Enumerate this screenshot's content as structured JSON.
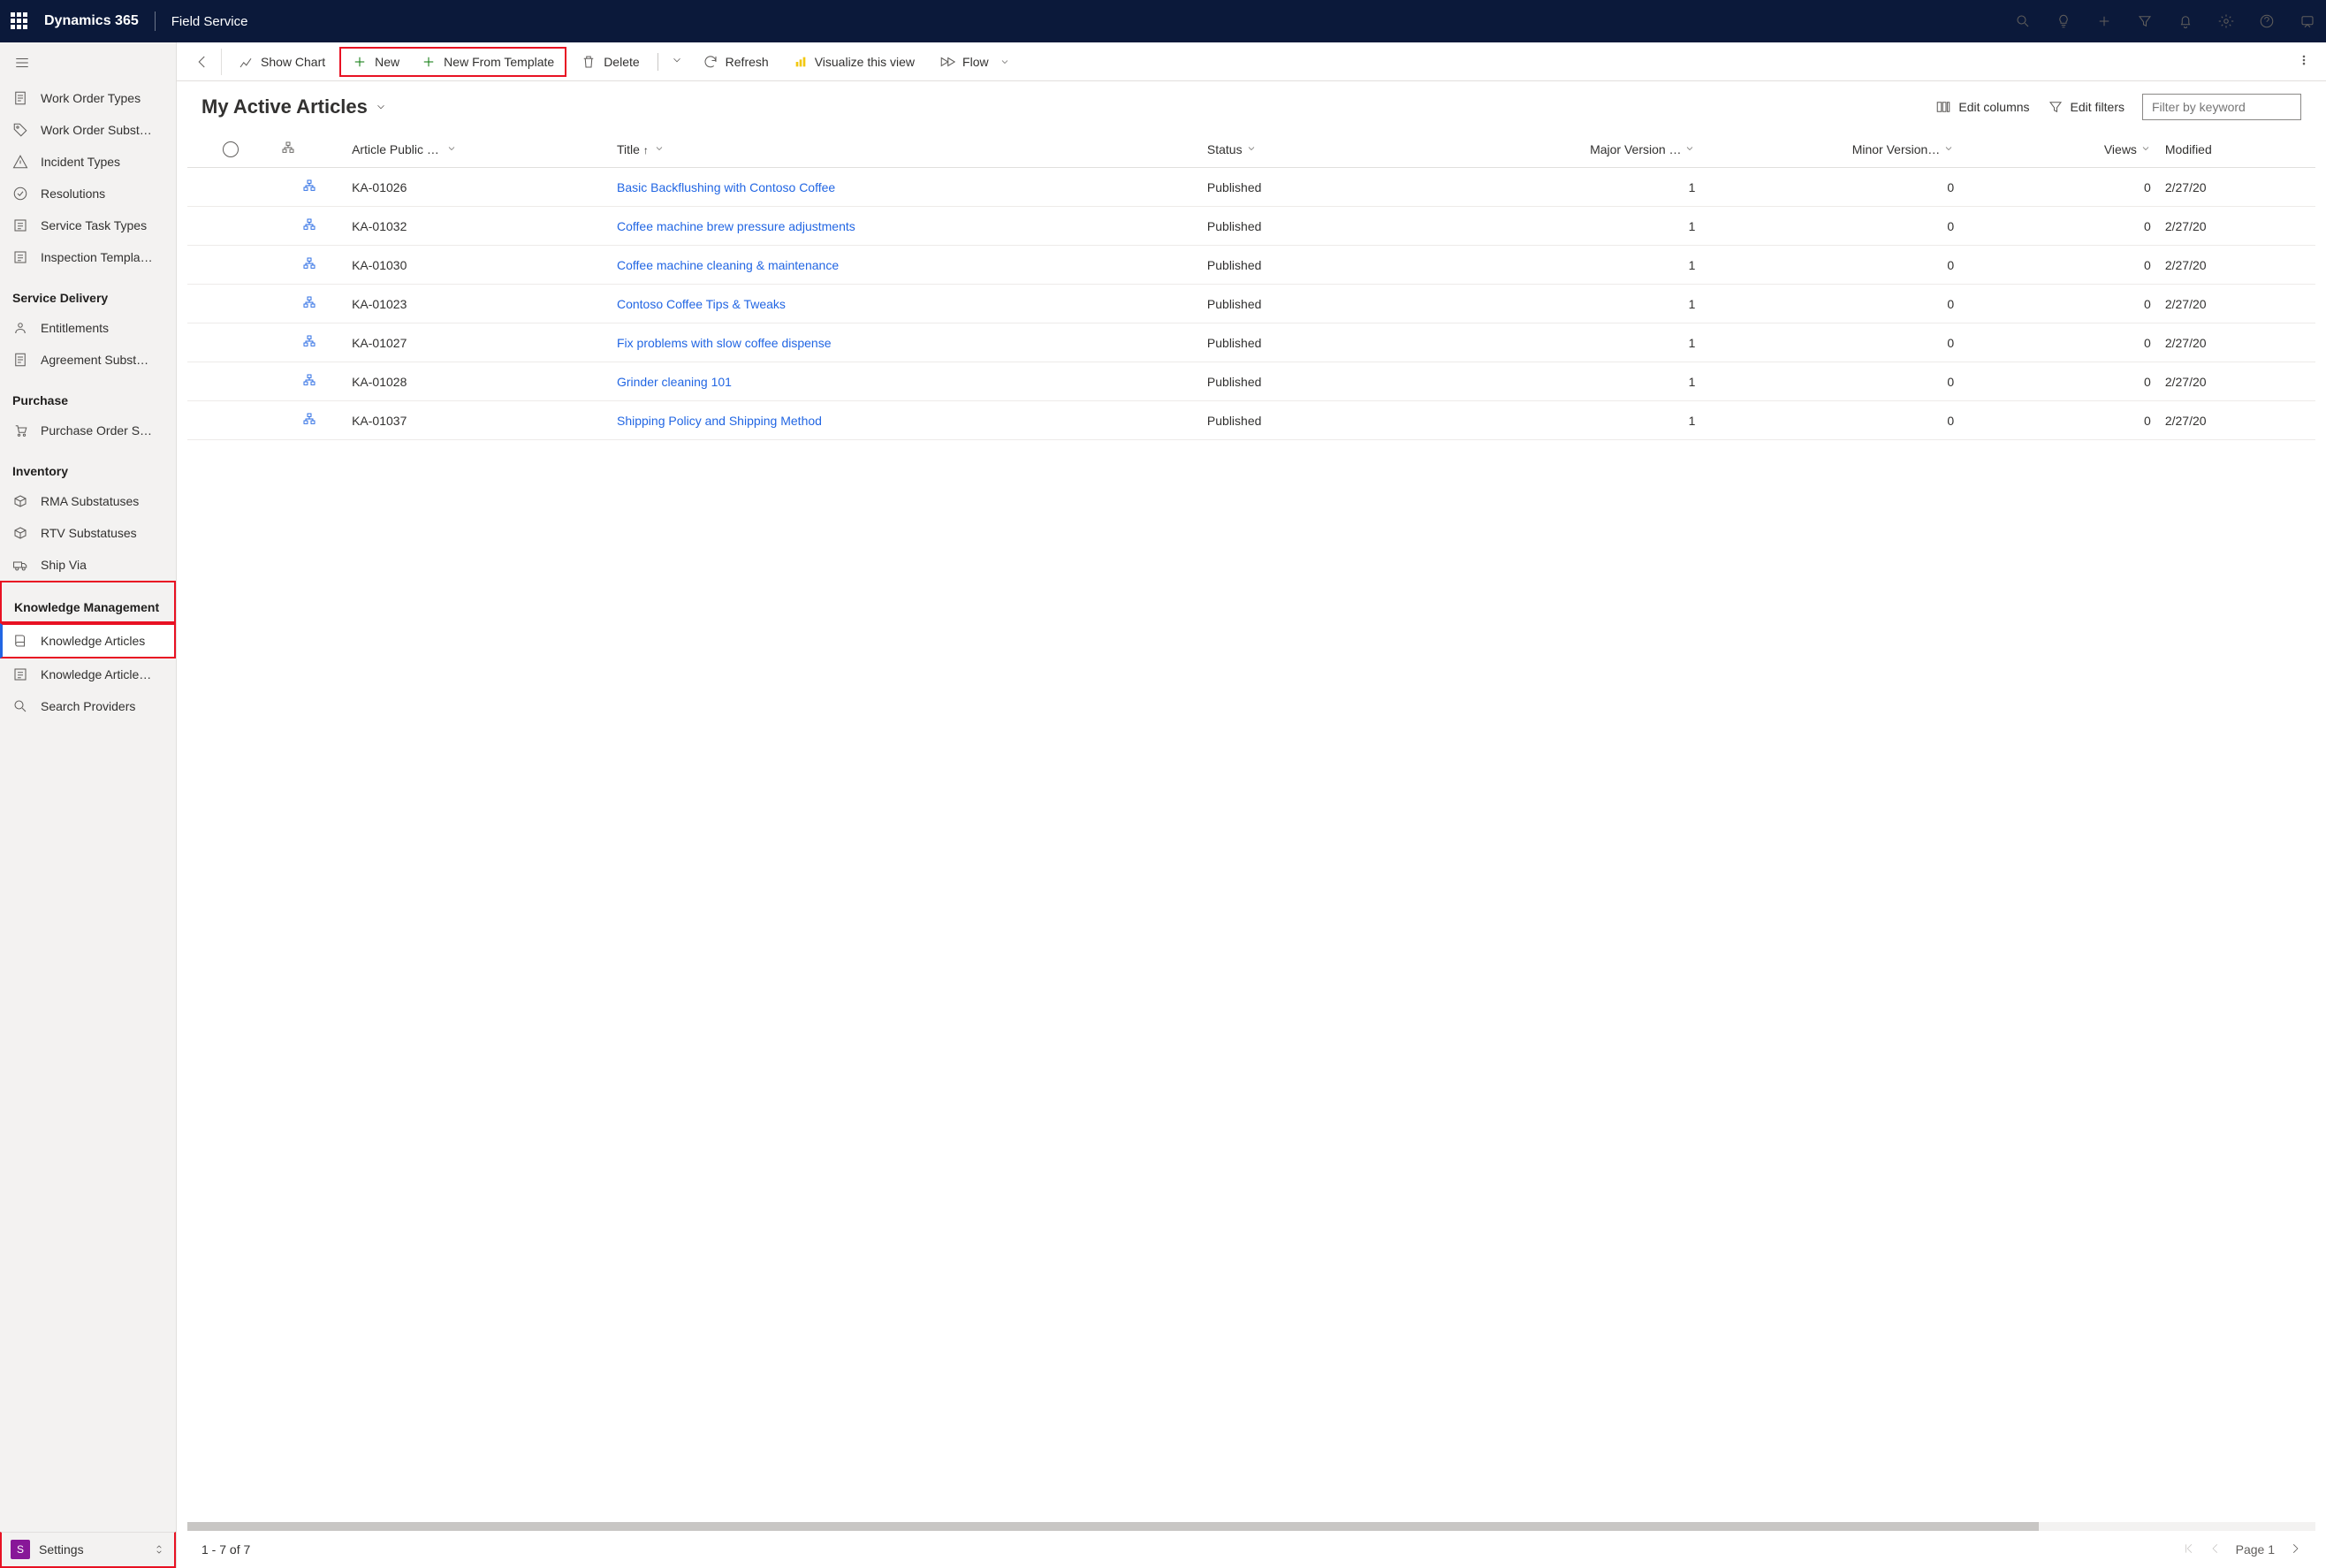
{
  "header": {
    "brand": "Dynamics 365",
    "app": "Field Service"
  },
  "sidebar": {
    "items_top": [
      {
        "label": "Work Order Types"
      },
      {
        "label": "Work Order Subst…"
      },
      {
        "label": "Incident Types"
      },
      {
        "label": "Resolutions"
      },
      {
        "label": "Service Task Types"
      },
      {
        "label": "Inspection Templa…"
      }
    ],
    "groups": [
      {
        "title": "Service Delivery",
        "items": [
          {
            "label": "Entitlements"
          },
          {
            "label": "Agreement Subst…"
          }
        ]
      },
      {
        "title": "Purchase",
        "items": [
          {
            "label": "Purchase Order S…"
          }
        ]
      },
      {
        "title": "Inventory",
        "items": [
          {
            "label": "RMA Substatuses"
          },
          {
            "label": "RTV Substatuses"
          },
          {
            "label": "Ship Via"
          }
        ]
      },
      {
        "title": "Knowledge Management",
        "highlight": true,
        "items": [
          {
            "label": "Knowledge Articles",
            "selected": true,
            "inHighlight": true
          },
          {
            "label": "Knowledge Article…"
          },
          {
            "label": "Search Providers"
          }
        ]
      }
    ],
    "footer": {
      "badge": "S",
      "label": "Settings"
    }
  },
  "commandbar": {
    "show_chart": "Show Chart",
    "new": "New",
    "new_template": "New From Template",
    "delete": "Delete",
    "refresh": "Refresh",
    "visualize": "Visualize this view",
    "flow": "Flow"
  },
  "view": {
    "title": "My Active Articles",
    "edit_columns": "Edit columns",
    "edit_filters": "Edit filters",
    "filter_placeholder": "Filter by keyword"
  },
  "columns": {
    "article_number": "Article Public …",
    "title": "Title",
    "status": "Status",
    "major": "Major Version …",
    "minor": "Minor Version…",
    "views": "Views",
    "modified": "Modified"
  },
  "rows": [
    {
      "num": "KA-01026",
      "title": "Basic Backflushing with Contoso Coffee",
      "status": "Published",
      "major": "1",
      "minor": "0",
      "views": "0",
      "modified": "2/27/20"
    },
    {
      "num": "KA-01032",
      "title": "Coffee machine brew pressure adjustments",
      "status": "Published",
      "major": "1",
      "minor": "0",
      "views": "0",
      "modified": "2/27/20"
    },
    {
      "num": "KA-01030",
      "title": "Coffee machine cleaning & maintenance",
      "status": "Published",
      "major": "1",
      "minor": "0",
      "views": "0",
      "modified": "2/27/20"
    },
    {
      "num": "KA-01023",
      "title": "Contoso Coffee Tips & Tweaks",
      "status": "Published",
      "major": "1",
      "minor": "0",
      "views": "0",
      "modified": "2/27/20"
    },
    {
      "num": "KA-01027",
      "title": "Fix problems with slow coffee dispense",
      "status": "Published",
      "major": "1",
      "minor": "0",
      "views": "0",
      "modified": "2/27/20"
    },
    {
      "num": "KA-01028",
      "title": "Grinder cleaning 101",
      "status": "Published",
      "major": "1",
      "minor": "0",
      "views": "0",
      "modified": "2/27/20"
    },
    {
      "num": "KA-01037",
      "title": "Shipping Policy and Shipping Method",
      "status": "Published",
      "major": "1",
      "minor": "0",
      "views": "0",
      "modified": "2/27/20"
    }
  ],
  "status": {
    "count_text": "1 - 7 of 7",
    "page_text": "Page 1"
  }
}
